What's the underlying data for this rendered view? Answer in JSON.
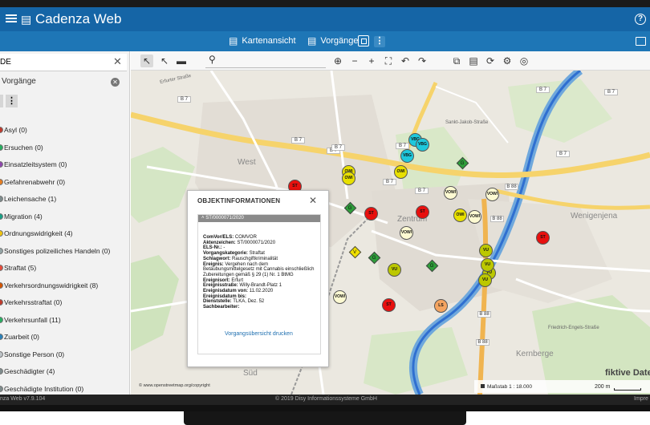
{
  "app": {
    "title": "Cadenza Web"
  },
  "nav": {
    "tabs": [
      {
        "label": "Kartenansicht"
      },
      {
        "label": "Vorgänge"
      }
    ]
  },
  "sidebar": {
    "search_value": "DE",
    "section_title": "Vorgänge",
    "items": [
      {
        "label": "Asyl (0)",
        "color": "#c0392b"
      },
      {
        "label": "Ersuchen (0)",
        "color": "#27ae60"
      },
      {
        "label": "Einsatzleitsystem (0)",
        "color": "#8e44ad"
      },
      {
        "label": "Gefahrenabwehr (0)",
        "color": "#e67e22"
      },
      {
        "label": "Leichensache (1)",
        "color": "#7f8c8d"
      },
      {
        "label": "Migration (4)",
        "color": "#16a085"
      },
      {
        "label": "Ordnungswidrigkeit (4)",
        "color": "#f1c40f"
      },
      {
        "label": "Sonstiges polizeiliches Handeln (0)",
        "color": "#95a5a6"
      },
      {
        "label": "Straftat (5)",
        "color": "#e74c3c"
      },
      {
        "label": "Verkehrsordnungswidrigkeit (8)",
        "color": "#d35400"
      },
      {
        "label": "Verkehrsstraftat (0)",
        "color": "#c0392b"
      },
      {
        "label": "Verkehrsunfall (11)",
        "color": "#27ae60"
      },
      {
        "label": "Zuarbeit (0)",
        "color": "#2980b9"
      },
      {
        "label": "Sonstige Person (0)",
        "color": "#bdc3c7"
      },
      {
        "label": "Geschädigter (4)",
        "color": "#7f8c8d"
      },
      {
        "label": "Geschädigte Institution (0)",
        "color": "#7f8c8d"
      }
    ]
  },
  "map": {
    "streets": [
      "Erfurter Straße",
      "Sankt-Jakob-Straße",
      "Friedrich-Engels-Straße"
    ],
    "road_labels": [
      "B 7",
      "B 7",
      "B 7",
      "B 7",
      "B 7",
      "B 7",
      "B 7",
      "B 7",
      "B 7",
      "B 7",
      "B 88",
      "B 88",
      "B 88",
      "B 88"
    ],
    "districts": [
      "West",
      "Zentrum",
      "Wenigenjena",
      "Kernberge",
      "Süd"
    ],
    "markers": [
      {
        "label": "VBG",
        "color": "#1ec8dc"
      },
      {
        "label": "VBG",
        "color": "#1ec8dc"
      },
      {
        "label": "VBG",
        "color": "#1ec8dc"
      },
      {
        "label": "OWI",
        "color": "#e8e000"
      },
      {
        "label": "OWI",
        "color": "#e8e000"
      },
      {
        "label": "OWI",
        "color": "#e8e000"
      },
      {
        "label": "OWI",
        "color": "#e8e000"
      },
      {
        "label": "VOWI",
        "color": "#fdfad2"
      },
      {
        "label": "VOWI",
        "color": "#fdfad2"
      },
      {
        "label": "VOWI",
        "color": "#fdfad2"
      },
      {
        "label": "VOWI",
        "color": "#fdfad2"
      },
      {
        "label": "VOWI",
        "color": "#fdfad2"
      },
      {
        "label": "ST",
        "color": "#e8100e"
      },
      {
        "label": "ST",
        "color": "#e8100e"
      },
      {
        "label": "ST",
        "color": "#e8100e"
      },
      {
        "label": "ST",
        "color": "#e8100e"
      },
      {
        "label": "ST",
        "color": "#e8100e"
      },
      {
        "label": "VU",
        "color": "#bcc800"
      },
      {
        "label": "VU",
        "color": "#bcc800"
      },
      {
        "label": "VU",
        "color": "#bcc800"
      },
      {
        "label": "VU",
        "color": "#bcc800"
      },
      {
        "label": "VU",
        "color": "#bcc800"
      },
      {
        "label": "LS",
        "color": "#f4a460"
      }
    ],
    "diamonds": [
      {
        "label": "G",
        "color": "#2e9e3a"
      },
      {
        "label": "G",
        "color": "#2e9e3a"
      },
      {
        "label": "G",
        "color": "#2e9e3a"
      },
      {
        "label": "G",
        "color": "#2e9e3a"
      },
      {
        "label": "V",
        "color": "#f0e000"
      }
    ],
    "attribution": "© www.openstreetmap.org/copyright",
    "scale_label": "Maßstab 1 : 18.000",
    "scale_distance": "200 m",
    "watermark": "fiktive Daten"
  },
  "popup": {
    "title": "OBJEKTINFORMATIONEN",
    "record_id": "ST/0000071/2020",
    "fields": [
      {
        "key": "ComVor/ELS:",
        "value": "COMVOR"
      },
      {
        "key": "Aktenzeichen:",
        "value": "ST/0000071/2020"
      },
      {
        "key": "ELS-Nr.:",
        "value": "-"
      },
      {
        "key": "Vorgangskategorie:",
        "value": "Straftat"
      },
      {
        "key": "Schlagwort:",
        "value": "Rauschgiftkriminalität"
      },
      {
        "key": "Ereignis:",
        "value": "Vergehen nach dem Betäubungsmittelgesetz mit Cannabis einschließlich Zubereitungen gemäß § 29 (1) Nr. 1 BtMG"
      },
      {
        "key": "Ereignisort:",
        "value": "Erfurt"
      },
      {
        "key": "Ereignisstraße:",
        "value": "Willy-Brandt-Platz 1"
      },
      {
        "key": "Ereignisdatum von:",
        "value": "11.02.2020"
      },
      {
        "key": "Ereignisdatum bis:",
        "value": ""
      },
      {
        "key": "Dienststelle:",
        "value": "TLKA, Dez. 52"
      },
      {
        "key": "Sachbearbeiter:",
        "value": ""
      }
    ],
    "link_label": "Vorgangsübersicht drucken"
  },
  "status": {
    "version": "nza Web v7.9.104",
    "copyright": "© 2019 Disy Informationssysteme GmbH",
    "imprint": "Impre"
  }
}
